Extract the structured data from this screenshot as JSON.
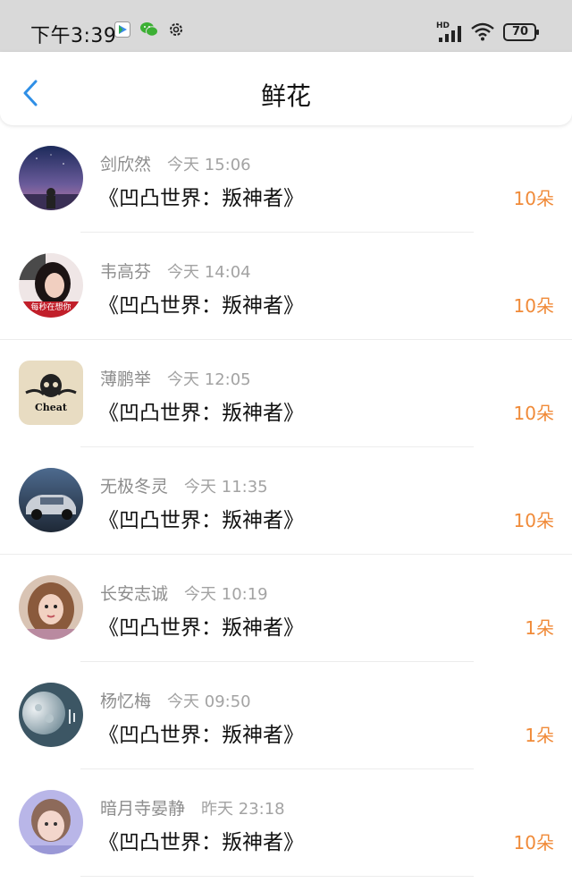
{
  "status_bar": {
    "time": "下午3:39",
    "battery": "70",
    "network_label": "HD"
  },
  "header": {
    "title": "鲜花"
  },
  "list": [
    {
      "user": "剑欣然",
      "time": "今天 15:06",
      "book": "《凹凸世界：叛神者》",
      "count": "10朵",
      "avatar": "avatar-night-sky"
    },
    {
      "user": "韦高芬",
      "time": "今天 14:04",
      "book": "《凹凸世界：叛神者》",
      "count": "10朵",
      "avatar": "avatar-girl-text",
      "avatar_text": "每秒在想你"
    },
    {
      "user": "薄鹏举",
      "time": "今天 12:05",
      "book": "《凹凸世界：叛神者》",
      "count": "10朵",
      "avatar": "avatar-skull-logo",
      "avatar_text": "Cheat"
    },
    {
      "user": "无极冬灵",
      "time": "今天 11:35",
      "book": "《凹凸世界：叛神者》",
      "count": "10朵",
      "avatar": "avatar-car"
    },
    {
      "user": "长安志诚",
      "time": "今天 10:19",
      "book": "《凹凸世界：叛神者》",
      "count": "1朵",
      "avatar": "avatar-girl-portrait"
    },
    {
      "user": "杨忆梅",
      "time": "今天 09:50",
      "book": "《凹凸世界：叛神者》",
      "count": "1朵",
      "avatar": "avatar-moon"
    },
    {
      "user": "暗月寺晏静",
      "time": "昨天 23:18",
      "book": "《凹凸世界：叛神者》",
      "count": "10朵",
      "avatar": "avatar-boy-portrait"
    }
  ],
  "colors": {
    "accent": "#2f8fe6",
    "count": "#f08a38",
    "status_bar_bg": "#d9d9d9"
  }
}
